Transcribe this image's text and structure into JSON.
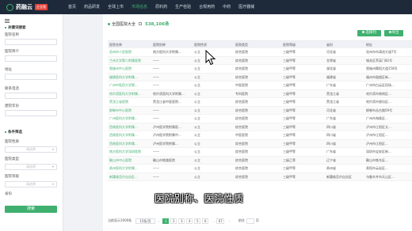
{
  "brand": {
    "name": "药融云",
    "badge": "企业版"
  },
  "nav": [
    "首页",
    "药品研发",
    "全球上市",
    "市场信息",
    "原料药",
    "生产检验",
    "合规用药",
    "中药",
    "医疗器械"
  ],
  "sidebar": {
    "section1": "关键词搜索",
    "fields": [
      "医院名称",
      "医院简介",
      "地址",
      "联系电话",
      "建院年份"
    ],
    "section2": "条件筛选",
    "filters": [
      {
        "label": "医院性质",
        "placeholder": "请选择"
      },
      {
        "label": "医院类型",
        "placeholder": "请选择"
      },
      {
        "label": "医院等级",
        "placeholder": "请选择"
      },
      {
        "label": "省份",
        "placeholder": ""
      }
    ],
    "search_button": "搜索"
  },
  "main": {
    "title": "全国医院大全",
    "count": "538,106条",
    "btn_select": "选择列",
    "btn_export": "导出"
  },
  "table": {
    "headers": [
      "医院名称",
      "医院别称",
      "医院性质",
      "医院类型",
      "医院等级",
      "省份",
      "地址"
    ],
    "rows": [
      [
        "沧州市人民医院",
        "南方医科大学附属...",
        "公立",
        "综合医院",
        "三级甲等",
        "河北省",
        "沧州市市清池大道7号"
      ],
      [
        "兰州大学第二附属医院",
        "——",
        "公立",
        "综合医院",
        "三级甲等",
        "甘肃省",
        "城关区萃英门82号"
      ],
      [
        "恩施州中心医院",
        "——",
        "公立",
        "综合医院",
        "三级甲等",
        "湖北省",
        "恩施州舞阳大道158号"
      ],
      [
        "福建医科大学附属...",
        "——",
        "公立",
        "综合医院",
        "三级甲等",
        "福建省",
        "福州市鼓楼区新..."
      ],
      [
        "广州中医药大学第...",
        "——",
        "公立",
        "中医医院",
        "三级甲等",
        "广东省",
        "广州市白云区机场..."
      ],
      [
        "哈尔滨医科大学附属...",
        "哈尔滨医科大学附属...",
        "公立",
        "专科医院",
        "三级甲等",
        "黑龙江省",
        "哈尔滨市南岗区..."
      ],
      [
        "黑龙江省医院",
        "黑龙江省中医医院...",
        "公立",
        "综合医院",
        "三级甲等",
        "黑龙江省",
        "哈尔滨市香坊区..."
      ],
      [
        "邯郸市中心医院",
        "——",
        "公立",
        "综合医院",
        "三级甲等",
        "河北省",
        "邯郸市丛台路59号"
      ],
      [
        "广州医科大学附属...",
        "——",
        "公立",
        "综合医院",
        "三级甲等",
        "广东省",
        "广州市海珠区..."
      ],
      [
        "西南医科大学附属...",
        "泸州医学院附属医...",
        "公立",
        "综合医院",
        "三级甲等",
        "四川省",
        "泸州市江阳区太..."
      ],
      [
        "西南医科大学附属...",
        "泸州医学院附属中...",
        "公立",
        "中医医院",
        "三级甲等",
        "四川省",
        "泸州市江阳区..."
      ],
      [
        "西南医科大学附属...",
        "泸州医学院附属...",
        "公立",
        "综合医院",
        "三级甲等",
        "四川省",
        "泸州市江阳区..."
      ],
      [
        "南方医科大学深圳医院",
        "——",
        "公立",
        "综合医院",
        "三级甲等",
        "广东省",
        "深圳市宝安区新..."
      ],
      [
        "鞍山市中心医院",
        "鞍山市铁路医院",
        "公立",
        "综合医院",
        "三级乙等",
        "辽宁省",
        "鞍山市铁东区..."
      ],
      [
        "贵州医科大学附属...",
        "——",
        "公立",
        "综合医院",
        "三级甲等",
        "贵州省",
        "贵阳市云岩区..."
      ],
      [
        "新疆维吾尔自治区...",
        "——",
        "公立",
        "综合医院",
        "三级甲等",
        "新疆维吾尔自治区",
        "乌鲁木齐市天山区..."
      ]
    ]
  },
  "pager": {
    "summary": "当前显示1000条",
    "per_page": "15条/页",
    "prev": "‹",
    "pages": [
      "1",
      "2",
      "3",
      "4",
      "5",
      "6"
    ],
    "ellipsis": "…",
    "last": "67",
    "next": "›",
    "goto": "前往",
    "page_suffix": "页"
  },
  "subtitle": "医院别称、医院性质",
  "colors": {
    "accent": "#3fb06f",
    "topbar": "#1e2a3a"
  }
}
